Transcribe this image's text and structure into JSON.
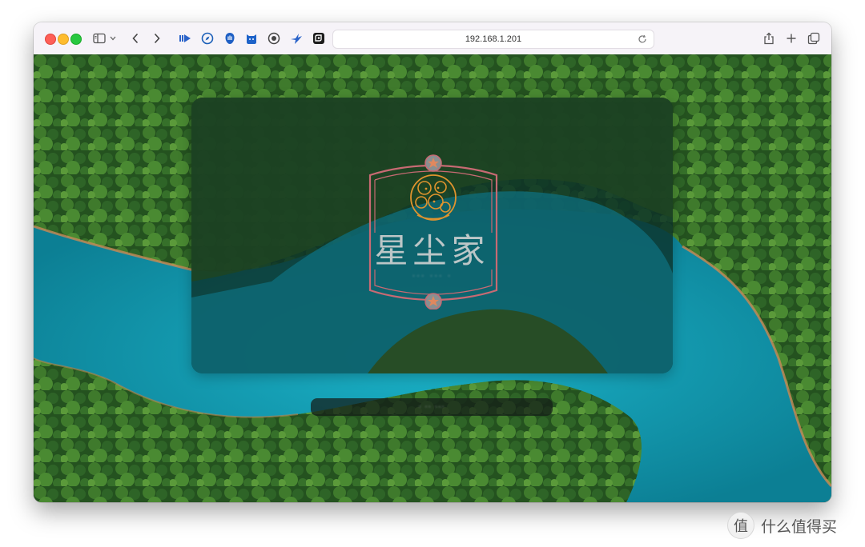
{
  "browser": {
    "url": "192.168.1.201",
    "toolbar_icons": [
      "sidebar-icon",
      "chevron-down-icon",
      "back-icon",
      "forward-icon",
      "extension-1-icon",
      "compass-icon",
      "hand-icon",
      "cat-icon",
      "target-icon",
      "bird-icon",
      "badge-icon",
      "reload-icon",
      "share-icon",
      "new-tab-icon",
      "tabs-overview-icon"
    ]
  },
  "page": {
    "brand_name": "星尘家",
    "brand_subtitle": "··· ··· ·",
    "input_text": "· ·· ···",
    "logo_name": "star-dust-logo"
  },
  "watermark": {
    "icon_char": "值",
    "text": "什么值得买"
  },
  "colors": {
    "frame_pink": "#c86a73",
    "logo_orange": "#e0942e",
    "water": "#1aa0b8",
    "forest": "#2c6a2a"
  }
}
